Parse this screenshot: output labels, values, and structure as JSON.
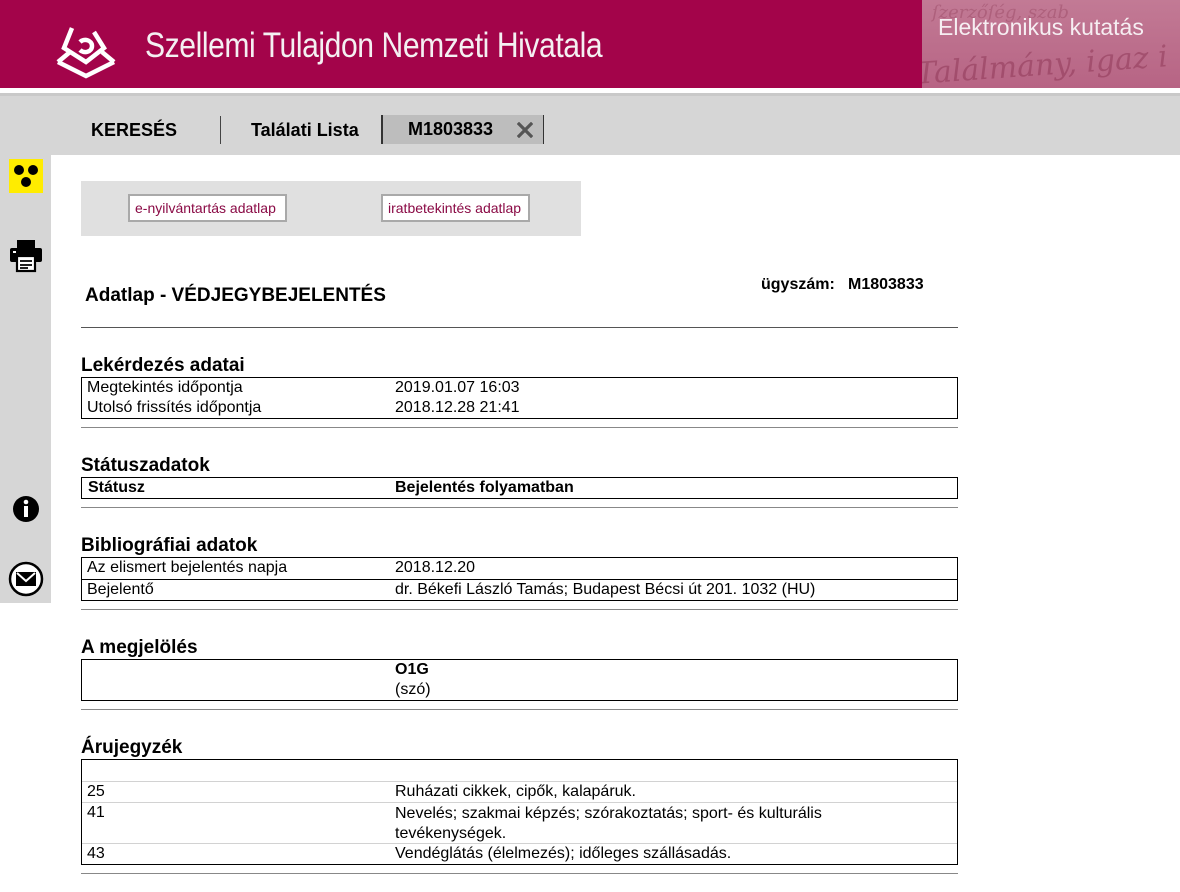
{
  "header": {
    "title": "Szellemi Tulajdon Nemzeti Hivatala",
    "right_title": "Elektronikus kutatás",
    "accent": "#a3044a"
  },
  "tabs": [
    {
      "label": "KERESÉS"
    },
    {
      "label": "Találati Lista"
    },
    {
      "label": "M1803833",
      "active": true
    }
  ],
  "sidebar": {
    "icons": [
      "accessibility-icon",
      "print-icon",
      "info-icon",
      "mail-icon"
    ]
  },
  "buttons": {
    "e_register": "e-nyilvántartás adatlap",
    "doc_inspection": "iratbetekintés adatlap"
  },
  "page": {
    "title": "Adatlap - VÉDJEGYBEJELENTÉS",
    "case_label": "ügyszám:",
    "case_number": "M1803833"
  },
  "sections": {
    "query": {
      "title": "Lekérdezés adatai",
      "rows": [
        {
          "key": "Megtekintés időpontja",
          "value": "2019.01.07 16:03"
        },
        {
          "key": "Utolsó frissítés időpontja",
          "value": "2018.12.28 21:41"
        }
      ]
    },
    "status": {
      "title": "Státuszadatok",
      "rows": [
        {
          "key": "Státusz",
          "value": "Bejelentés folyamatban"
        }
      ]
    },
    "biblio": {
      "title": "Bibliográfiai adatok",
      "rows": [
        {
          "key": "Az elismert bejelentés napja",
          "value": "2018.12.20"
        },
        {
          "key": "Bejelentő",
          "value": "dr. Békefi László Tamás; Budapest Bécsi út 201. 1032 (HU)"
        }
      ]
    },
    "mark": {
      "title": "A megjelölés",
      "name": "O1G",
      "type": "(szó)"
    },
    "goods": {
      "title": "Árujegyzék",
      "rows": [
        {
          "key": "25",
          "value": "Ruházati cikkek, cipők, kalapáruk."
        },
        {
          "key": "41",
          "value": "Nevelés; szakmai képzés; szórakoztatás; sport- és kulturális tevékenységek."
        },
        {
          "key": "43",
          "value": "Vendéglátás (élelmezés); időleges szállásadás."
        }
      ]
    }
  }
}
